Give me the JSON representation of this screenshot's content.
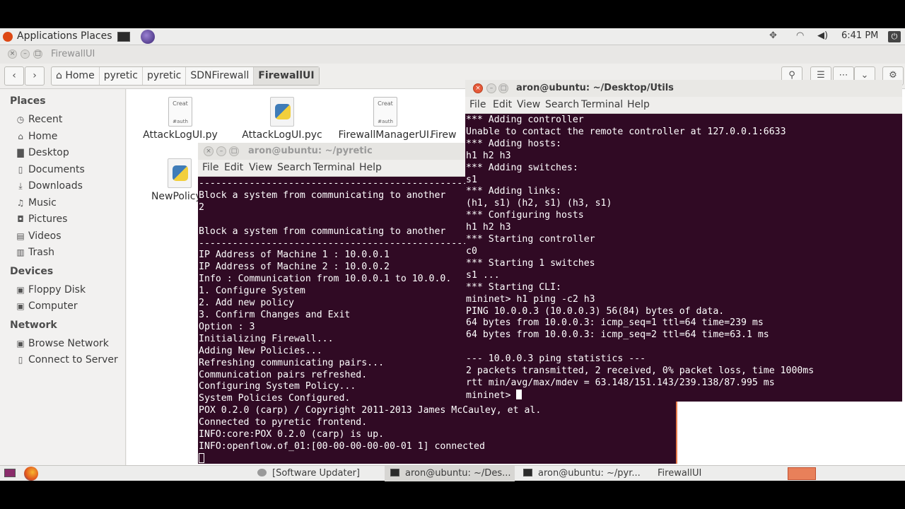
{
  "panel": {
    "applications": "Applications",
    "places": "Places",
    "clock": "6:41 PM",
    "power": "⏻",
    "dropbox": "✥",
    "wifi": "◠",
    "volume": "◀)",
    "mail": "✉"
  },
  "file_manager": {
    "title": "FirewallUI",
    "back": "‹",
    "forward": "›",
    "breadcrumbs": [
      "Home",
      "pyretic",
      "pyretic",
      "SDNFirewall",
      "FirewallUI"
    ],
    "search_icon": "⚲",
    "list_view": "☰",
    "grid_view": "⋯",
    "sort": "⌄",
    "settings": "⚙",
    "sidebar": {
      "places_header": "Places",
      "places": [
        "Recent",
        "Home",
        "Desktop",
        "Documents",
        "Downloads",
        "Music",
        "Pictures",
        "Videos",
        "Trash"
      ],
      "devices_header": "Devices",
      "devices": [
        "Floppy Disk",
        "Computer"
      ],
      "network_header": "Network",
      "network": [
        "Browse Network",
        "Connect to Server"
      ]
    },
    "files": [
      {
        "name": "AttackLogUI.py",
        "icon": "Creat",
        "icon2": "#auth"
      },
      {
        "name": "AttackLogUI.pyc",
        "icon": "",
        "icon2": ""
      },
      {
        "name": "FirewallManagerUI.",
        "icon": "Creat",
        "icon2": "#auth"
      },
      {
        "name": "Firew",
        "icon": "",
        "icon2": ""
      },
      {
        "name": "NewPolicyU",
        "icon": "",
        "icon2": ""
      }
    ]
  },
  "terminal_pyretic": {
    "title": "aron@ubuntu: ~/pyretic",
    "menu": [
      "File",
      "Edit",
      "View",
      "Search",
      "Terminal",
      "Help"
    ],
    "lines": [
      "------------------------------------------------------------",
      "Block a system from communicating to another",
      "2",
      "",
      "Block a system from communicating to another",
      "------------------------------------------------------------",
      "IP Address of Machine 1 : 10.0.0.1",
      "IP Address of Machine 2 : 10.0.0.2",
      "Info : Communication from 10.0.0.1 to 10.0.0.",
      "1. Configure System",
      "2. Add new policy",
      "3. Confirm Changes and Exit",
      "Option : 3",
      "Initializing Firewall...",
      "Adding New Policies...",
      "Refreshing communicating pairs...",
      "Communication pairs refreshed.",
      "Configuring System Policy...",
      "System Policies Configured.",
      "POX 0.2.0 (carp) / Copyright 2011-2013 James McCauley, et al.",
      "Connected to pyretic frontend.",
      "INFO:core:POX 0.2.0 (carp) is up.",
      "INFO:openflow.of_01:[00-00-00-00-00-01 1] connected"
    ]
  },
  "terminal_utils": {
    "title": "aron@ubuntu: ~/Desktop/Utils",
    "menu": [
      "File",
      "Edit",
      "View",
      "Search",
      "Terminal",
      "Help"
    ],
    "lines": [
      "*** Adding controller",
      "Unable to contact the remote controller at 127.0.0.1:6633",
      "*** Adding hosts:",
      "h1 h2 h3",
      "*** Adding switches:",
      "s1",
      "*** Adding links:",
      "(h1, s1) (h2, s1) (h3, s1)",
      "*** Configuring hosts",
      "h1 h2 h3",
      "*** Starting controller",
      "c0",
      "*** Starting 1 switches",
      "s1 ...",
      "*** Starting CLI:",
      "mininet> h1 ping -c2 h3",
      "PING 10.0.0.3 (10.0.0.3) 56(84) bytes of data.",
      "64 bytes from 10.0.0.3: icmp_seq=1 ttl=64 time=239 ms",
      "64 bytes from 10.0.0.3: icmp_seq=2 ttl=64 time=63.1 ms",
      "",
      "--- 10.0.0.3 ping statistics ---",
      "2 packets transmitted, 2 received, 0% packet loss, time 1000ms",
      "rtt min/avg/max/mdev = 63.148/151.143/239.138/87.995 ms"
    ],
    "prompt": "mininet> "
  },
  "taskbar": {
    "tasks": [
      "[Software Updater]",
      "aron@ubuntu: ~/Des...",
      "aron@ubuntu: ~/pyr...",
      "FirewallUI"
    ]
  },
  "colors": {
    "terminal_bg": "#300a24",
    "close_button": "#e65a3a"
  }
}
